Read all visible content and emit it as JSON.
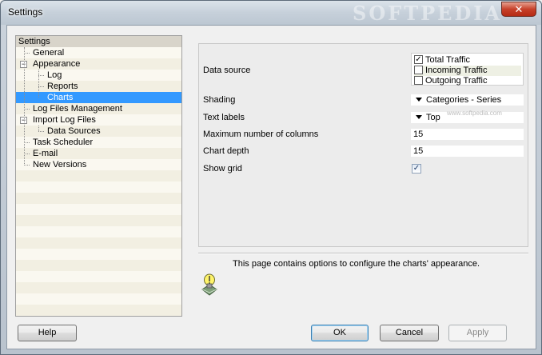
{
  "window": {
    "title": "Settings",
    "watermark": "SOFTPEDIA",
    "close_glyph": "✕"
  },
  "tree": {
    "header": "Settings",
    "items": [
      {
        "label": "General",
        "level": 1
      },
      {
        "label": "Appearance",
        "level": 1,
        "expander": "−"
      },
      {
        "label": "Log",
        "level": 2
      },
      {
        "label": "Reports",
        "level": 2
      },
      {
        "label": "Charts",
        "level": 2,
        "selected": true
      },
      {
        "label": "Log Files Management",
        "level": 1
      },
      {
        "label": "Import Log Files",
        "level": 1,
        "expander": "−"
      },
      {
        "label": "Data Sources",
        "level": 2
      },
      {
        "label": "Task Scheduler",
        "level": 1
      },
      {
        "label": "E-mail",
        "level": 1
      },
      {
        "label": "New Versions",
        "level": 1
      }
    ]
  },
  "settings": {
    "data_source": {
      "label": "Data source",
      "options": [
        {
          "label": "Total Traffic",
          "checked": true
        },
        {
          "label": "Incoming Traffic",
          "checked": false
        },
        {
          "label": "Outgoing Traffic",
          "checked": false
        }
      ]
    },
    "shading": {
      "label": "Shading",
      "value": "Categories - Series"
    },
    "text_labels": {
      "label": "Text labels",
      "value": "Top"
    },
    "max_columns": {
      "label": "Maximum number of columns",
      "value": "15"
    },
    "chart_depth": {
      "label": "Chart depth",
      "value": "15"
    },
    "show_grid": {
      "label": "Show grid",
      "checked": true,
      "glyph": "✓"
    },
    "softpedia_small": "www.softpedia.com"
  },
  "description": {
    "text": "This page contains options to configure the charts' appearance."
  },
  "buttons": {
    "help": "Help",
    "ok": "OK",
    "cancel": "Cancel",
    "apply": "Apply"
  },
  "colors": {
    "selection": "#3399ff",
    "tree_odd": "#f2efe2",
    "tree_even": "#faf8f0",
    "close": "#c7412a"
  }
}
